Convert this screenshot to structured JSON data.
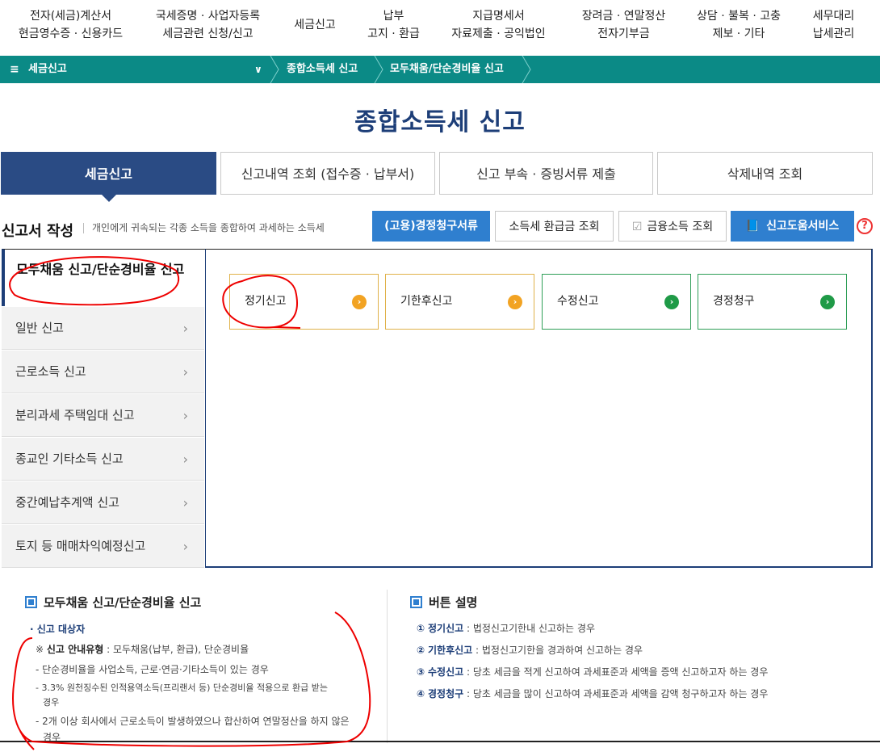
{
  "topnav": [
    {
      "line1": "전자(세금)계산서",
      "line2": "현금영수증 · 신용카드"
    },
    {
      "line1": "국세증명 · 사업자등록",
      "line2": "세금관련 신청/신고"
    },
    {
      "line1": "세금신고",
      "line2": ""
    },
    {
      "line1": "납부",
      "line2": "고지 · 환급"
    },
    {
      "line1": "지급명세서",
      "line2": "자료제출 · 공익법인"
    },
    {
      "line1": "장려금 · 연말정산",
      "line2": "전자기부금"
    },
    {
      "line1": "상담 · 불복 · 고충",
      "line2": "제보 · 기타"
    },
    {
      "line1": "세무대리",
      "line2": "납세관리"
    }
  ],
  "breadcrumb": {
    "menu_label": "세금신고",
    "level2": "종합소득세 신고",
    "level3": "모두채움/단순경비율 신고"
  },
  "page_title": "종합소득세 신고",
  "tabs": [
    "세금신고",
    "신고내역 조회 (접수증 · 납부서)",
    "신고 부속 · 증빙서류 제출",
    "삭제내역 조회"
  ],
  "section": {
    "title": "신고서 작성",
    "desc": "개인에게 귀속되는 각종 소득을 종합하여 과세하는 소득세"
  },
  "actions": {
    "correction_docs": "(고용)경정청구서류",
    "refund_lookup": "소득세 환급금 조회",
    "financial_income": "금융소득 조회",
    "help_service": "신고도움서비스",
    "help_mark": "?"
  },
  "leftmenu": {
    "head": "모두채움 신고/단순경비율 신고",
    "items": [
      "일반 신고",
      "근로소득 신고",
      "분리과세 주택임대 신고",
      "종교인 기타소득 신고",
      "중간예납추계액 신고",
      "토지 등 매매차익예정신고"
    ]
  },
  "cards": [
    "정기신고",
    "기한후신고",
    "수정신고",
    "경정청구"
  ],
  "colors": {
    "orange": "#f2a323",
    "green": "#1f9a47",
    "navy": "#1d3e78",
    "teal": "#0b8a86"
  },
  "info_left": {
    "title": "모두채움 신고/단순경비율 신고",
    "target_label": "· 신고 대상자",
    "guide_prefix": "※ ",
    "guide_bold": "신고 안내유형",
    "guide_rest": " : 모두채움(납부, 환급), 단순경비율",
    "lines": [
      "- 단순경비율을 사업소득, 근로·연금·기타소득이 있는 경우",
      "- 3.3% 원천징수된 인적용역소득(프리랜서 등) 단순경비율 적용으로 환급 받는",
      "경우",
      "- 2개 이상 회사에서 근로소득이 발생하였으나 합산하여 연말정산을 하지 않은",
      "경우"
    ]
  },
  "info_right": {
    "title": "버튼 설명",
    "rows": [
      {
        "num": "①",
        "name": "정기신고",
        "text": " : 법정신고기한내 신고하는 경우"
      },
      {
        "num": "②",
        "name": "기한후신고",
        "text": " : 법정신고기한을 경과하여 신고하는 경우"
      },
      {
        "num": "③",
        "name": "수정신고",
        "text": " : 당초 세금을 적게 신고하여 과세표준과 세액을 증액 신고하고자 하는 경우"
      },
      {
        "num": "④",
        "name": "경정청구",
        "text": " : 당초 세금을 많이 신고하여 과세표준과 세액을 감액 청구하고자 하는 경우"
      }
    ]
  }
}
